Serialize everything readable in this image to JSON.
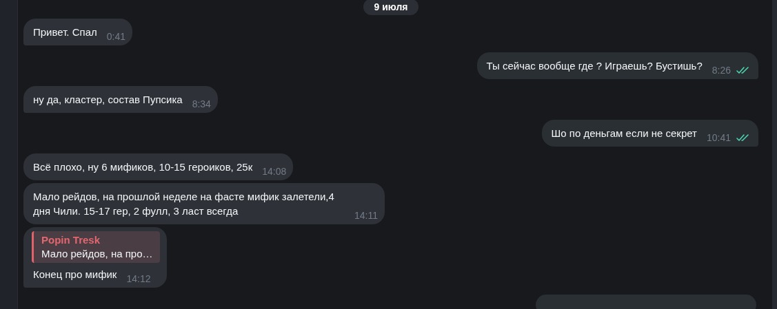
{
  "date_label": "9 июля",
  "messages": [
    {
      "kind": "incoming",
      "text": "Привет. Спал",
      "time": "0:41",
      "tail": true
    },
    {
      "kind": "outgoing",
      "text": "Ты сейчас вообще где ? Играешь? Бустишь?",
      "time": "8:26",
      "read": true,
      "tail": true
    },
    {
      "kind": "incoming",
      "text": "ну да, кластер, состав Пупсика",
      "time": "8:34",
      "tail": true
    },
    {
      "kind": "outgoing",
      "text": "Шо по деньгам если не секрет",
      "time": "10:41",
      "read": true,
      "tail": true
    },
    {
      "kind": "incoming",
      "text": "Всё плохо, ну 6 мификов, 10-15 героиков, 25к",
      "time": "14:08",
      "tail": false
    },
    {
      "kind": "incoming",
      "text": "Мало рейдов, на прошлой неделе на фасте мифик залетели,4 дня Чили. 15-17 гер, 2 фулл, 3 ласт всегда",
      "time": "14:11",
      "tail": false
    },
    {
      "kind": "incoming",
      "text": "Конец про мифик",
      "time": "14:12",
      "tail": true,
      "reply": {
        "author": "Popin Tresk",
        "text": "Мало рейдов, на про…"
      }
    }
  ]
}
